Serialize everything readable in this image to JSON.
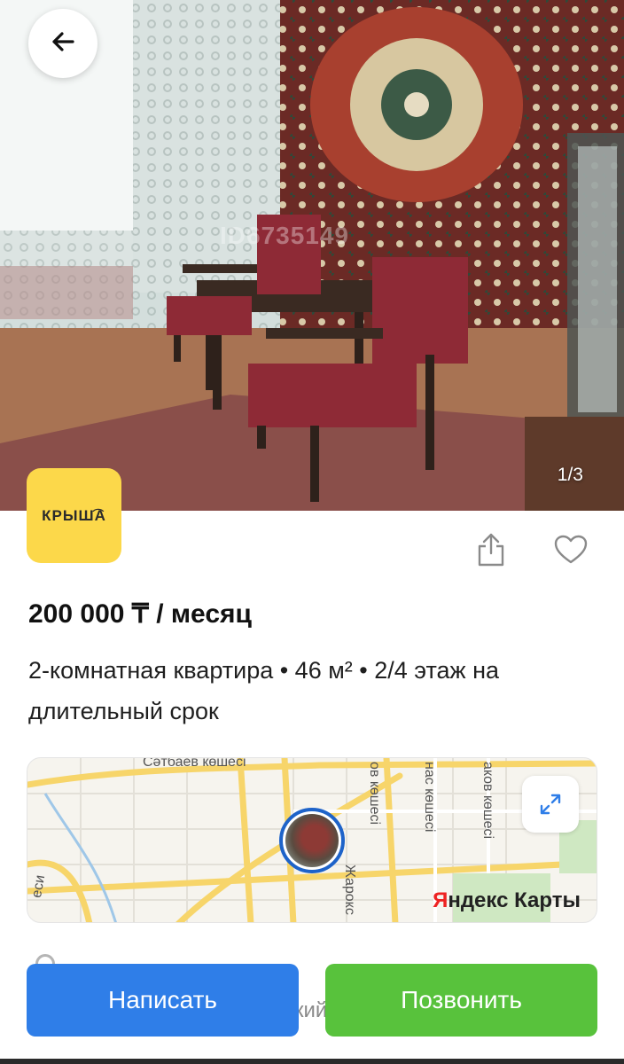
{
  "listing": {
    "photo_counter": "1/3",
    "watermark": "ID6735149",
    "price": "200 000 ₸ / месяц",
    "description": "2-комнатная квартира • 46 м² • 2/4 этаж на длительный срок",
    "behind_text": "кий"
  },
  "brand": {
    "logo_text": "КРЫШ͡А",
    "logo_color": "#fcd84a"
  },
  "map": {
    "street_labels": [
      "Сәтбаев көшесі",
      "ов көшесі",
      "нас көшесі",
      "аков көшесі",
      "Жарокс",
      "еси"
    ],
    "provider_prefix": "Я",
    "provider_rest": "ндекс Карты"
  },
  "actions": {
    "write_label": "Написать",
    "call_label": "Позвонить"
  },
  "icons": {
    "back": "arrow-left-icon",
    "share": "share-icon",
    "favorite": "heart-icon",
    "expand": "expand-icon"
  },
  "colors": {
    "write": "#2f7ee8",
    "call": "#58c23c",
    "pin": "#1e63c9"
  }
}
